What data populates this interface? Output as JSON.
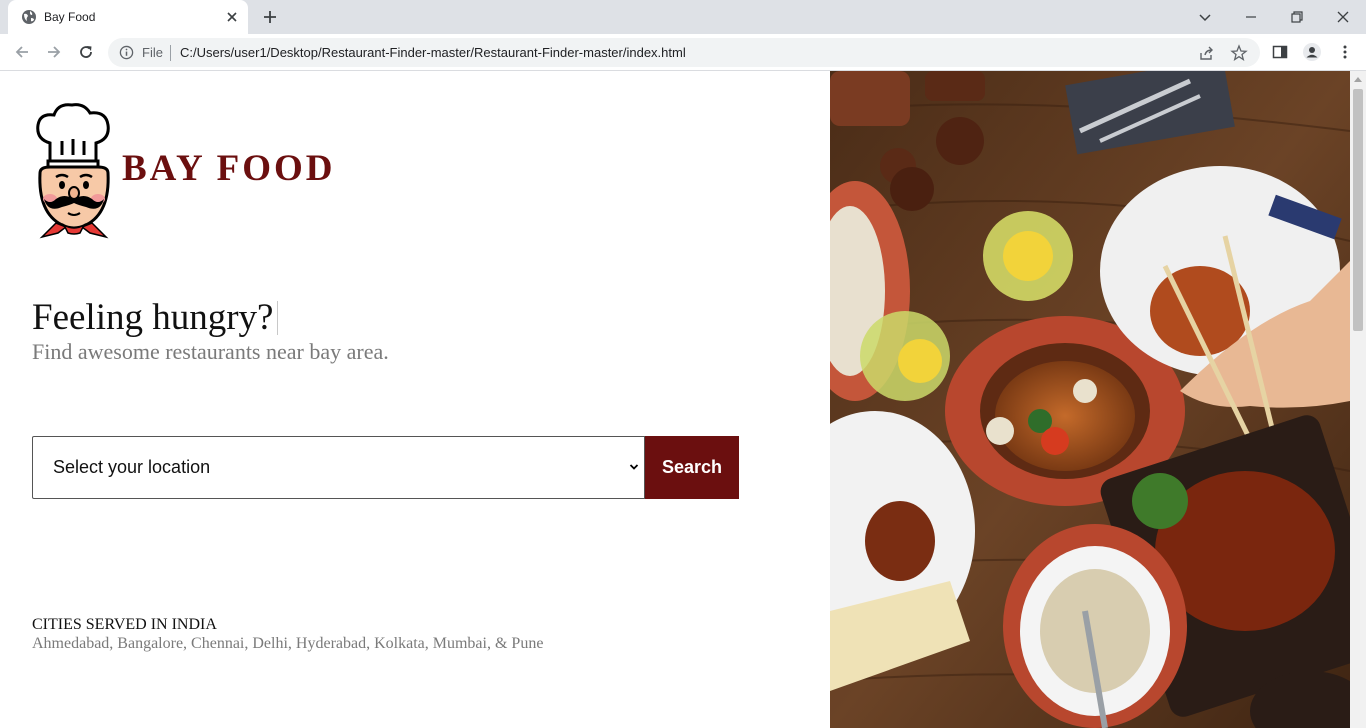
{
  "browser": {
    "tab_title": "Bay Food",
    "scheme_label": "File",
    "url": "C:/Users/user1/Desktop/Restaurant-Finder-master/Restaurant-Finder-master/index.html"
  },
  "page": {
    "brand": "BAY FOOD",
    "headline": "Feeling hungry?",
    "subheadline": "Find awesome restaurants near bay area.",
    "location_select": {
      "selected": "Select your location"
    },
    "search_button": "Search",
    "cities_heading": "CITIES SERVED IN INDIA",
    "cities_list": "Ahmedabad, Bangalore, Chennai, Delhi, Hyderabad, Kolkata, Mumbai, & Pune"
  },
  "colors": {
    "brand": "#6b0f0f",
    "muted_text": "#7a7a7a",
    "chrome_bg": "#dee1e6"
  },
  "icons": [
    "globe-icon",
    "close-icon",
    "plus-icon",
    "chevron-down-icon",
    "minimize-icon",
    "restore-icon",
    "back-icon",
    "forward-icon",
    "reload-icon",
    "info-icon",
    "share-icon",
    "star-icon",
    "side-panel-icon",
    "profile-icon",
    "menu-icon",
    "chef-logo"
  ]
}
